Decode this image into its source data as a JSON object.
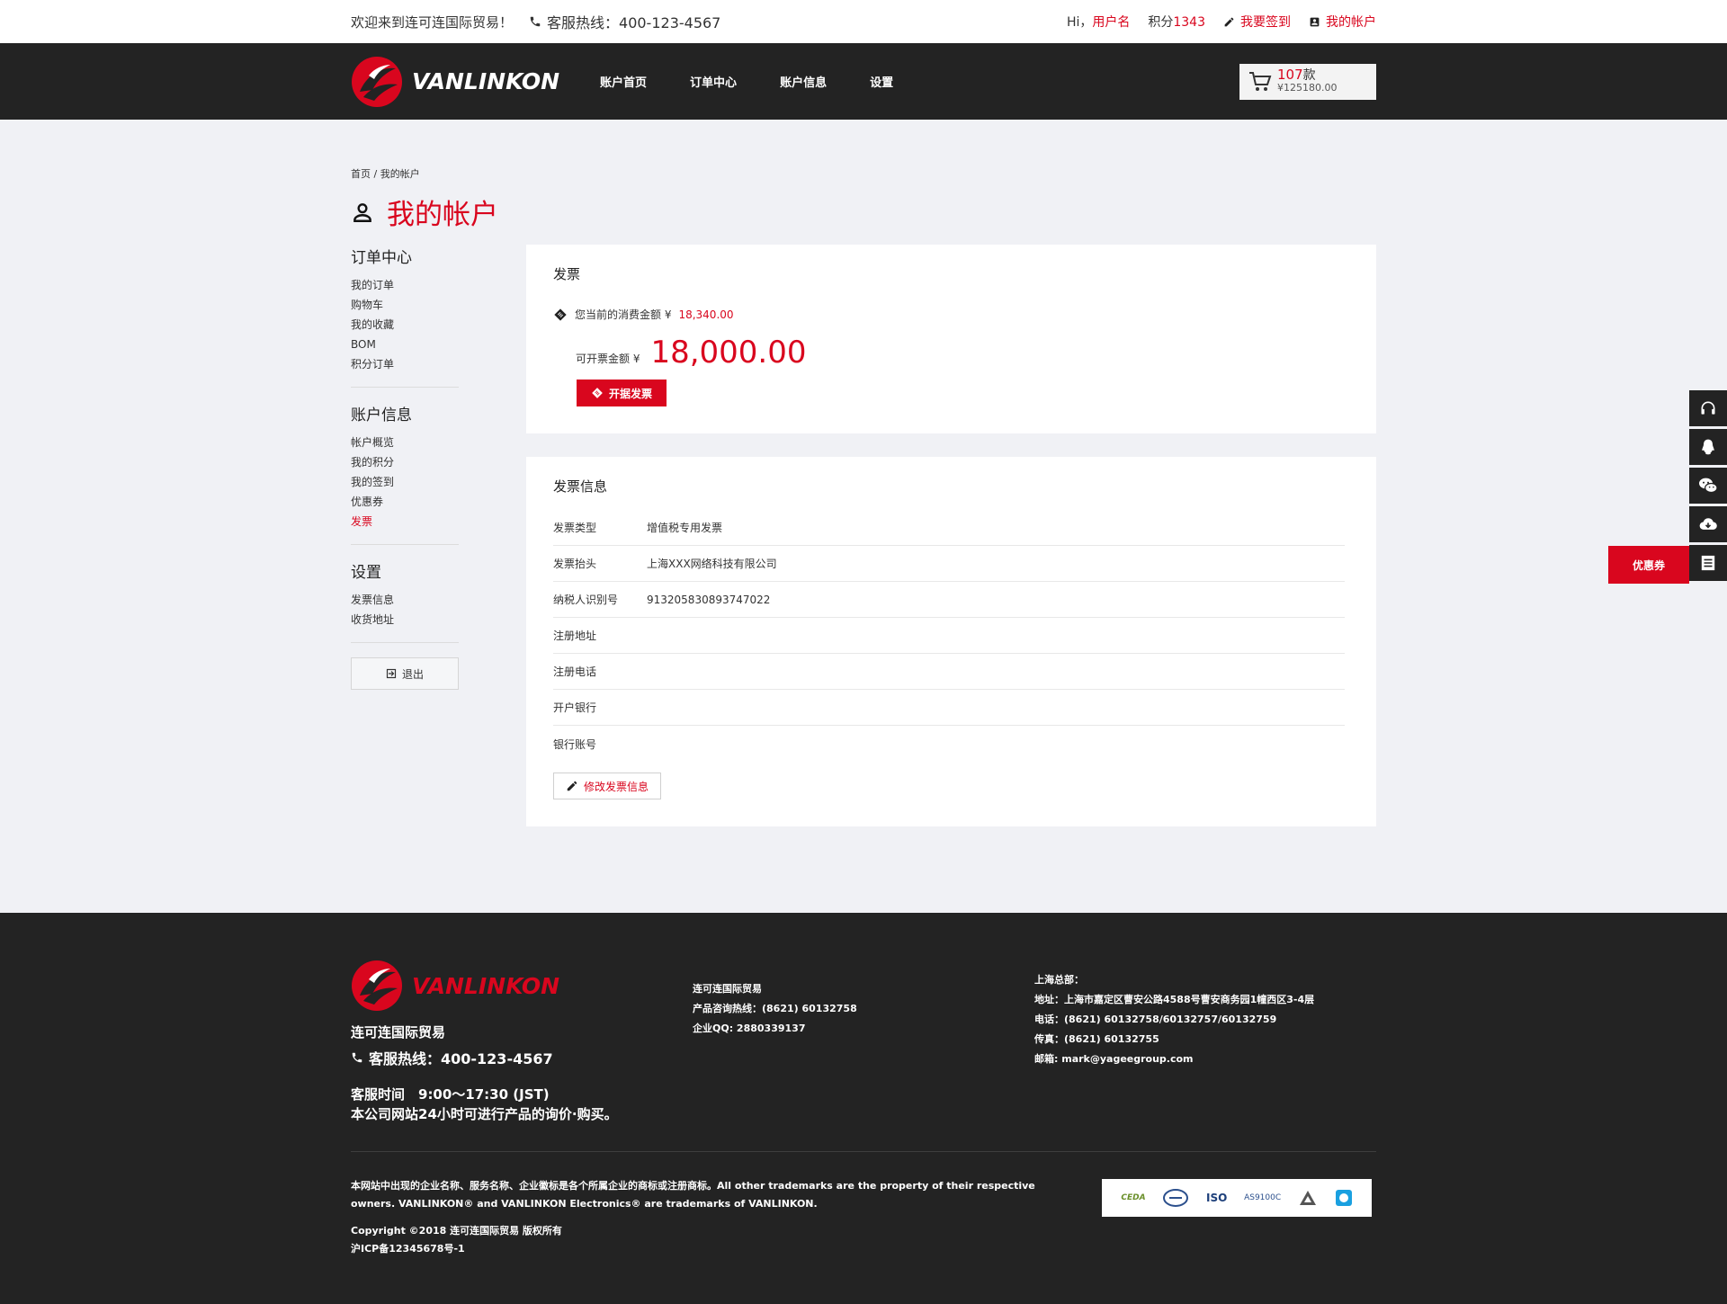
{
  "topbar": {
    "welcome": "欢迎来到连可连国际贸易！",
    "hotline": "客服热线：400-123-4567",
    "greeting": "Hi，",
    "username": "用户名",
    "points_label": "积分",
    "points_value": "1343",
    "checkin": "我要签到",
    "account": "我的帐户"
  },
  "nav": {
    "brand": "VANLINKON",
    "links": [
      "账户首页",
      "订单中心",
      "账户信息",
      "设置"
    ],
    "cart_count": "107",
    "cart_unit": "款",
    "cart_total": "¥125180.00"
  },
  "breadcrumb": {
    "home": "首页",
    "sep": "/",
    "current": "我的帐户"
  },
  "page_title": "我的帐户",
  "sidebar": {
    "groups": [
      {
        "title": "订单中心",
        "items": [
          "我的订单",
          "购物车",
          "我的收藏",
          "BOM",
          "积分订单"
        ]
      },
      {
        "title": "账户信息",
        "items": [
          "帐户概览",
          "我的积分",
          "我的签到",
          "优惠券",
          "发票"
        ]
      },
      {
        "title": "设置",
        "items": [
          "发票信息",
          "收货地址"
        ]
      }
    ],
    "logout": "退出"
  },
  "invoice": {
    "title": "发票",
    "spend_label": "您当前的消费金额 ¥",
    "spend_value": "18,340.00",
    "available_label": "可开票金额 ¥",
    "available_value": "18,000.00",
    "button": "开据发票"
  },
  "invoice_info": {
    "title": "发票信息",
    "rows": [
      {
        "k": "发票类型",
        "v": "增值税专用发票"
      },
      {
        "k": "发票抬头",
        "v": "上海XXX网络科技有限公司"
      },
      {
        "k": "纳税人识别号",
        "v": "913205830893747022"
      },
      {
        "k": "注册地址",
        "v": ""
      },
      {
        "k": "注册电话",
        "v": ""
      },
      {
        "k": "开户银行",
        "v": ""
      },
      {
        "k": "银行账号",
        "v": ""
      }
    ],
    "edit_button": "修改发票信息"
  },
  "floatbar": {
    "coupon": "优惠券"
  },
  "footer": {
    "company": "连可连国际贸易",
    "hotline": "客服热线：400-123-4567",
    "service_time": "客服时间　9:00～17:30 (JST)",
    "service_note": "本公司网站24小时可进行产品的询价·购买。",
    "col2": [
      "连可连国际贸易",
      "产品咨询热线：(8621) 60132758",
      "企业QQ: 2880339137"
    ],
    "col3": [
      "上海总部：",
      "地址：上海市嘉定区曹安公路4588号曹安商务园1幢西区3-4层",
      "电话：(8621) 60132758/60132757/60132759",
      "传真：(8621) 60132755",
      "邮箱: mark@yageegroup.com"
    ],
    "legal": "本网站中出现的企业名称、服务名称、企业徽标是各个所属企业的商标或注册商标。All other trademarks are the property of their respective owners. VANLINKON® and VANLINKON Electronics® are trademarks of VANLINKON.",
    "copyright": "Copyright ©2018 连可连国际贸易 版权所有",
    "icp": "沪ICP备12345678号-1",
    "certs": [
      "CEDA",
      "ISO",
      "AS9100C"
    ]
  }
}
